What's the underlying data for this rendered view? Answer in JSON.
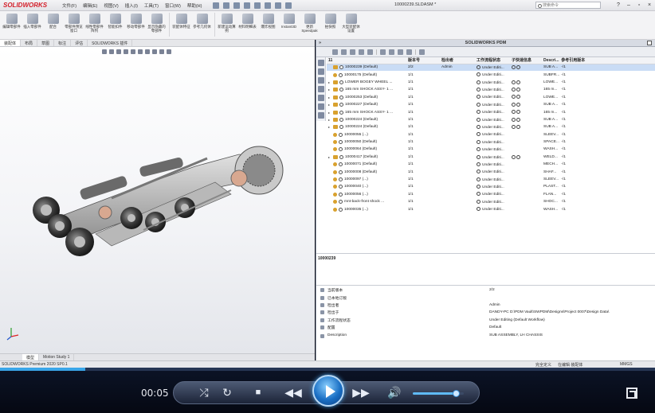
{
  "app": {
    "logo": "SOLIDWORKS",
    "menus": [
      "文件(F)",
      "编辑(E)",
      "视图(V)",
      "插入(I)",
      "工具(T)",
      "窗口(W)",
      "帮助(H)"
    ],
    "document_title": "10000239.SLDASM *",
    "search_placeholder": "搜索命令"
  },
  "ribbon": [
    {
      "label": "编辑零部件"
    },
    {
      "label": "插入零部件"
    },
    {
      "label": "配合"
    },
    {
      "label": "零部件预览窗口"
    },
    {
      "label": "线性零部件阵列"
    },
    {
      "label": "智能扣件"
    },
    {
      "label": "移动零部件"
    },
    {
      "label": "显示隐藏的零部件"
    },
    {
      "label": "装配体特征"
    },
    {
      "label": "参考几何体"
    },
    {
      "label": "新建运动算例"
    },
    {
      "label": "材料明细表"
    },
    {
      "label": "爆炸视图"
    },
    {
      "label": "Instant3D"
    },
    {
      "label": "更新Speedpak"
    },
    {
      "label": "拍快照"
    },
    {
      "label": "大型装配体设置"
    }
  ],
  "command_tabs": [
    "装配体",
    "布局",
    "草图",
    "标注",
    "评估",
    "SOLIDWORKS 插件"
  ],
  "bottom_tabs": [
    "模型",
    "Motion Study 1"
  ],
  "pdm": {
    "header": "SOLIDWORKS PDM",
    "columns": [
      "11",
      "版本号",
      "检出者",
      "工作流程状态",
      "子快速信息",
      "Descri...",
      "参考引用版本"
    ],
    "rows": [
      {
        "name": "10000239  (Default)",
        "version": "2/2",
        "checked_by": "Admin",
        "state": "Under Editi...",
        "quick": 2,
        "desc": "SUB A...",
        "ref": "-/1",
        "kind": "asm",
        "tri": "",
        "selected": true
      },
      {
        "name": "10000175  (Default)",
        "version": "1/1",
        "checked_by": "",
        "state": "Under Editi...",
        "quick": 0,
        "desc": "SUBFR...",
        "ref": "-/1",
        "kind": "part",
        "tri": "",
        "selected": false
      },
      {
        "name": "LOWER BOGEY WHEEL ...",
        "version": "1/1",
        "checked_by": "",
        "state": "Under Editi...",
        "quick": 2,
        "desc": "LOWE...",
        "ref": "-/1",
        "kind": "asm",
        "tri": "▸",
        "selected": false
      },
      {
        "name": "165 mm SHOCK ASSY- 1 ...",
        "version": "1/1",
        "checked_by": "",
        "state": "Under Editi...",
        "quick": 2,
        "desc": "165 m...",
        "ref": "-/1",
        "kind": "asm",
        "tri": "▸",
        "selected": false
      },
      {
        "name": "10000253  (Default)",
        "version": "1/1",
        "checked_by": "",
        "state": "Under Editi...",
        "quick": 2,
        "desc": "LOWE...",
        "ref": "-/1",
        "kind": "asm",
        "tri": "▸",
        "selected": false
      },
      {
        "name": "10000227  (Default)",
        "version": "1/1",
        "checked_by": "",
        "state": "Under Editi...",
        "quick": 2,
        "desc": "SUB A...",
        "ref": "-/1",
        "kind": "asm",
        "tri": "▸",
        "selected": false
      },
      {
        "name": "165 mm SHOCK ASSY- 1 ...",
        "version": "1/1",
        "checked_by": "",
        "state": "Under Editi...",
        "quick": 2,
        "desc": "165 m...",
        "ref": "-/1",
        "kind": "asm",
        "tri": "▸",
        "selected": false
      },
      {
        "name": "10000224  (Default)",
        "version": "1/1",
        "checked_by": "",
        "state": "Under Editi...",
        "quick": 2,
        "desc": "SUB A...",
        "ref": "-/1",
        "kind": "asm",
        "tri": "▸",
        "selected": false
      },
      {
        "name": "10000224  (Default)",
        "version": "1/1",
        "checked_by": "",
        "state": "Under Editi...",
        "quick": 2,
        "desc": "SUB A...",
        "ref": "-/1",
        "kind": "asm",
        "tri": "▸",
        "selected": false
      },
      {
        "name": "10000055  (...)",
        "version": "1/1",
        "checked_by": "",
        "state": "Under Editi...",
        "quick": 0,
        "desc": "SLEEV...",
        "ref": "-/1",
        "kind": "part",
        "tri": "",
        "selected": false
      },
      {
        "name": "10000050  (Default)",
        "version": "1/1",
        "checked_by": "",
        "state": "Under Editi...",
        "quick": 0,
        "desc": "SPACE...",
        "ref": "-/1",
        "kind": "part",
        "tri": "",
        "selected": false
      },
      {
        "name": "10000064  (Default)",
        "version": "1/1",
        "checked_by": "",
        "state": "Under Editi...",
        "quick": 0,
        "desc": "WASH...",
        "ref": "-/1",
        "kind": "part",
        "tri": "",
        "selected": false
      },
      {
        "name": "10000417  (Default)",
        "version": "1/1",
        "checked_by": "",
        "state": "Under Editi...",
        "quick": 2,
        "desc": "WELD...",
        "ref": "-/1",
        "kind": "asm",
        "tri": "▸",
        "selected": false
      },
      {
        "name": "10000071  (Default)",
        "version": "1/1",
        "checked_by": "",
        "state": "Under Editi...",
        "quick": 0,
        "desc": "MECH...",
        "ref": "-/1",
        "kind": "part",
        "tri": "",
        "selected": false
      },
      {
        "name": "10000008  (Default)",
        "version": "1/1",
        "checked_by": "",
        "state": "Under Editi...",
        "quick": 0,
        "desc": "SHAF...",
        "ref": "-/1",
        "kind": "part",
        "tri": "",
        "selected": false
      },
      {
        "name": "10000097  (...)",
        "version": "1/1",
        "checked_by": "",
        "state": "Under Editi...",
        "quick": 0,
        "desc": "SLEEV...",
        "ref": "-/1",
        "kind": "part",
        "tri": "",
        "selected": false
      },
      {
        "name": "10000040  (...)",
        "version": "1/1",
        "checked_by": "",
        "state": "Under Editi...",
        "quick": 0,
        "desc": "PLAST...",
        "ref": "-/1",
        "kind": "part",
        "tri": "",
        "selected": false
      },
      {
        "name": "10000056  (...)",
        "version": "1/1",
        "checked_by": "",
        "state": "Under Editi...",
        "quick": 0,
        "desc": "FLAN...",
        "ref": "-/1",
        "kind": "part",
        "tri": "",
        "selected": false
      },
      {
        "name": "mnt-back-front shock ...",
        "version": "1/1",
        "checked_by": "",
        "state": "Under Editi...",
        "quick": 0,
        "desc": "SHOC...",
        "ref": "-/1",
        "kind": "part",
        "tri": "",
        "selected": false
      },
      {
        "name": "10000035  (...)",
        "version": "1/1",
        "checked_by": "",
        "state": "Under Editi...",
        "quick": 0,
        "desc": "WASH...",
        "ref": "-/1",
        "kind": "part",
        "tri": "",
        "selected": false
      }
    ],
    "preview_label": "10000239",
    "properties": [
      {
        "key": "当前版本",
        "value": "2/2"
      },
      {
        "key": "已本地订版",
        "value": ""
      },
      {
        "key": "检出者",
        "value": "Admin"
      },
      {
        "key": "检出于",
        "value": "DANDY-PC  D:\\PDM Vault\\SWPDM\\Designs\\Project 0007\\Design Data\\"
      },
      {
        "key": "工作流程状态",
        "value": "Under Editing (Default Workflow)"
      },
      {
        "key": "配置",
        "value": "Default"
      },
      {
        "key": "Description",
        "value": "SUB ASSEMBLY, LH CHASSIS"
      }
    ]
  },
  "statusbar": {
    "left": "SOLIDWORKS Premium 2020 SP0.1",
    "middle": [
      "完全定义",
      "在编辑 装配体"
    ],
    "units": "MMGS"
  },
  "player": {
    "time": "00:05",
    "progress": 0.13,
    "volume": 0.85
  },
  "colors": {
    "accent": "#3aa6e8",
    "selected_row": "#c9dcf5",
    "brand": "#d4202b"
  }
}
